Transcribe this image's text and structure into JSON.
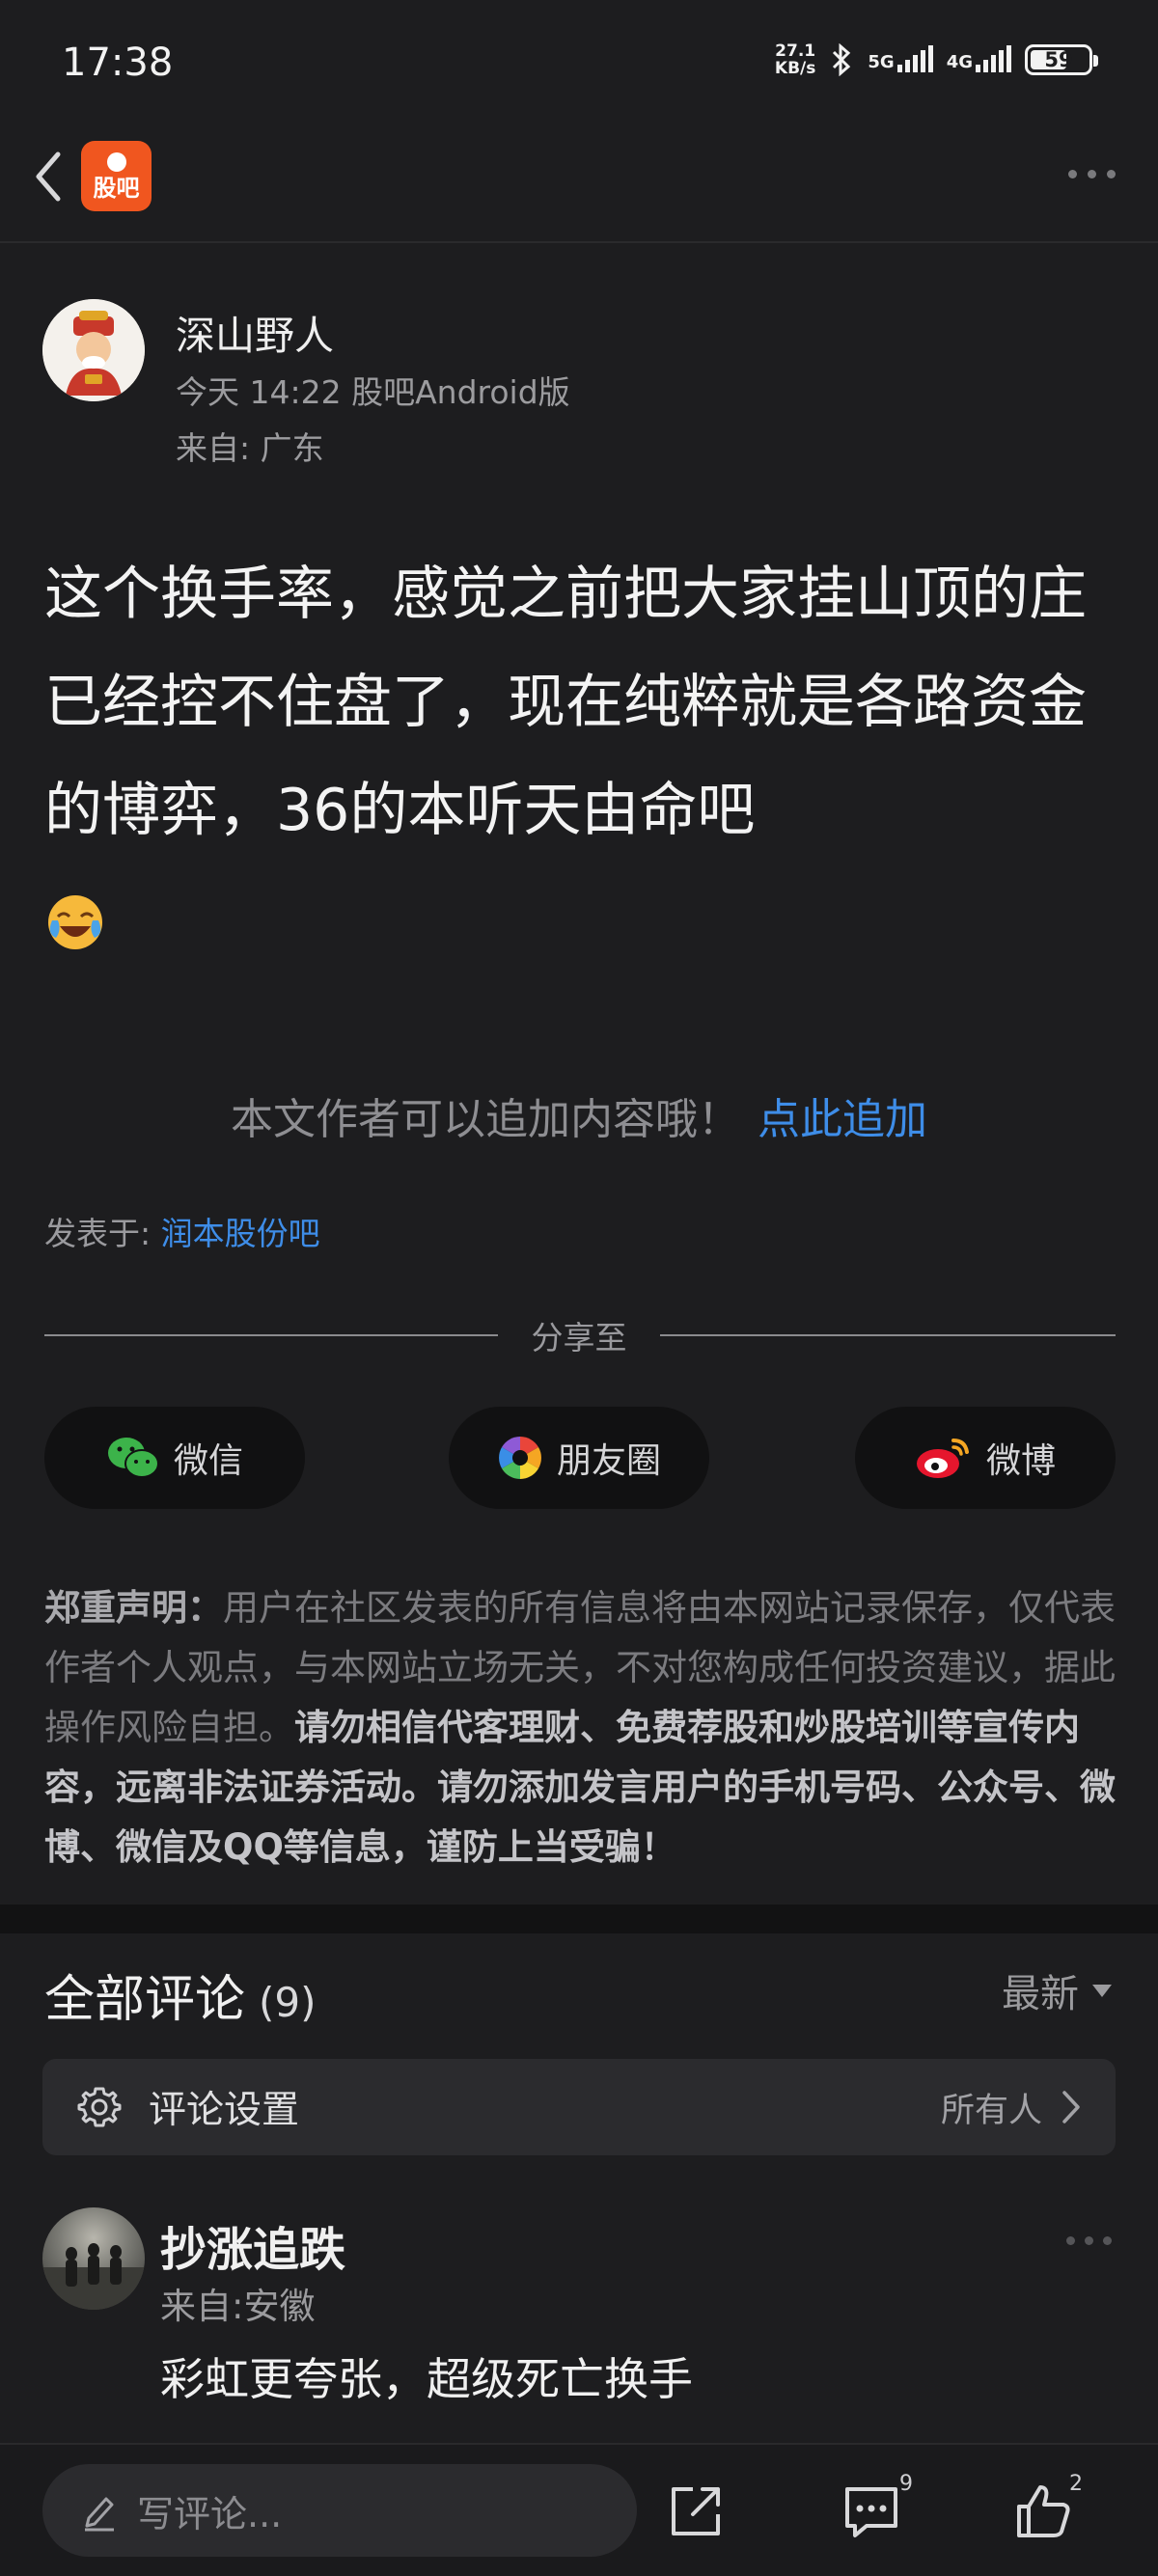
{
  "status_bar": {
    "time": "17:38",
    "net_speed": "27.1",
    "net_speed_unit": "KB/s",
    "net1": "5G",
    "net2": "4G",
    "battery": "59"
  },
  "header": {
    "logo_text": "股吧"
  },
  "post": {
    "author": "深山野人",
    "time_source": "今天 14:22 股吧Android版",
    "location": "来自: 广东",
    "body": "这个换手率，感觉之前把大家挂山顶的庄已经控不住盘了，现在纯粹就是各路资金的博弈，36的本听天由命吧",
    "append_prompt": "本文作者可以追加内容哦！",
    "append_link": "点此追加",
    "posted_in_label": "发表于: ",
    "posted_in_bar": "润本股份吧"
  },
  "share": {
    "label": "分享至",
    "wechat": "微信",
    "moments": "朋友圈",
    "weibo": "微博"
  },
  "disclaimer": {
    "title": "郑重声明：",
    "normal": "用户在社区发表的所有信息将由本网站记录保存，仅代表作者个人观点，与本网站立场无关，不对您构成任何投资建议，据此操作风险自担。",
    "highlight": "请勿相信代客理财、免费荐股和炒股培训等宣传内容，远离非法证券活动。请勿添加发言用户的手机号码、公众号、微博、微信及QQ等信息，谨防上当受骗！"
  },
  "comments": {
    "title": "全部评论",
    "count": "(9)",
    "sort": "最新",
    "settings_label": "评论设置",
    "settings_value": "所有人",
    "first": {
      "name": "抄涨追跌",
      "location": "来自:安徽",
      "text": "彩虹更夸张，超级死亡换手"
    }
  },
  "bottom_bar": {
    "input_placeholder": "写评论...",
    "comment_count": "9",
    "like_count": "2"
  },
  "colors": {
    "background": "#1d1d1f",
    "link": "#3e8de8",
    "logo": "#f0561f"
  }
}
